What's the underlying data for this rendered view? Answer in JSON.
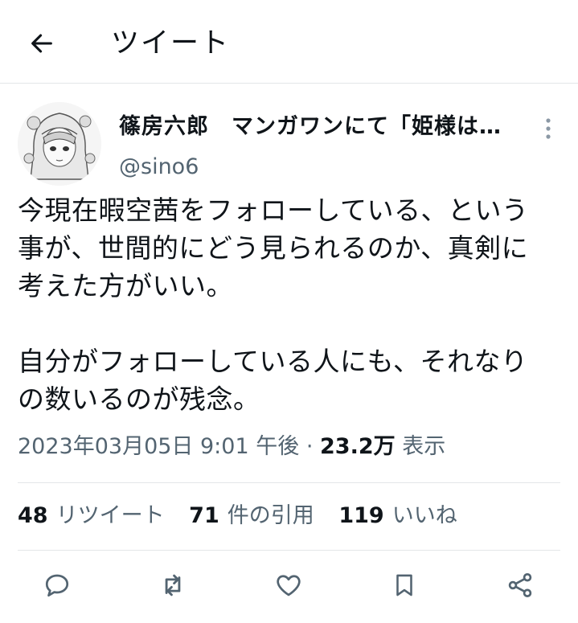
{
  "header": {
    "title": "ツイート",
    "back_icon": "arrow-left-icon"
  },
  "author": {
    "name": "篠房六郎　マンガワンにて「姫様は…",
    "handle": "@sino6"
  },
  "tweet": {
    "lines": [
      "今現在暇空茜をフォローしている、という",
      "事が、世間的にどう見られるのか、真剣に",
      "考えた方がいい。",
      "",
      "自分がフォローしている人にも、それなり",
      "の数いるのが残念。"
    ]
  },
  "meta": {
    "timestamp": "2023年03月05日 9:01 午後",
    "separator": "·",
    "views_count": "23.2万",
    "views_label": "表示"
  },
  "stats": {
    "retweets_count": "48",
    "retweets_label": "リツイート",
    "quotes_count": "71",
    "quotes_label": "件の引用",
    "likes_count": "119",
    "likes_label": "いいね"
  },
  "actions": [
    "reply-icon",
    "retweet-icon",
    "like-icon",
    "bookmark-icon",
    "share-icon"
  ],
  "colors": {
    "text": "#0f1419",
    "secondary": "#536471",
    "divider": "#e3e6e8"
  }
}
